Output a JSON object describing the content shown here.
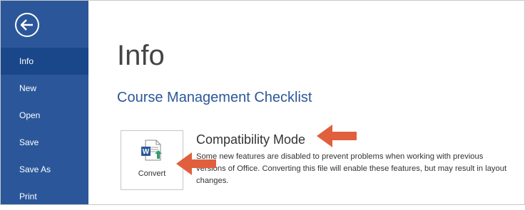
{
  "sidebar": {
    "back_button_icon": "back-arrow-icon",
    "items": [
      {
        "label": "Info",
        "active": true
      },
      {
        "label": "New",
        "active": false
      },
      {
        "label": "Open",
        "active": false
      },
      {
        "label": "Save",
        "active": false
      },
      {
        "label": "Save As",
        "active": false
      },
      {
        "label": "Print",
        "active": false
      }
    ],
    "background_color": "#2b579a",
    "active_color": "#19478a"
  },
  "main": {
    "page_title": "Info",
    "document_title": "Course Management Checklist",
    "compatibility": {
      "button_label": "Convert",
      "button_icon": "word-document-convert-icon",
      "title": "Compatibility Mode",
      "description": "Some new features are disabled to prevent problems when working with previous versions of Office. Converting this file will enable these features, but may result in layout changes."
    }
  },
  "annotations": {
    "arrow_color": "#e0603e",
    "arrow_icon": "left-pointing-arrow-icon"
  }
}
